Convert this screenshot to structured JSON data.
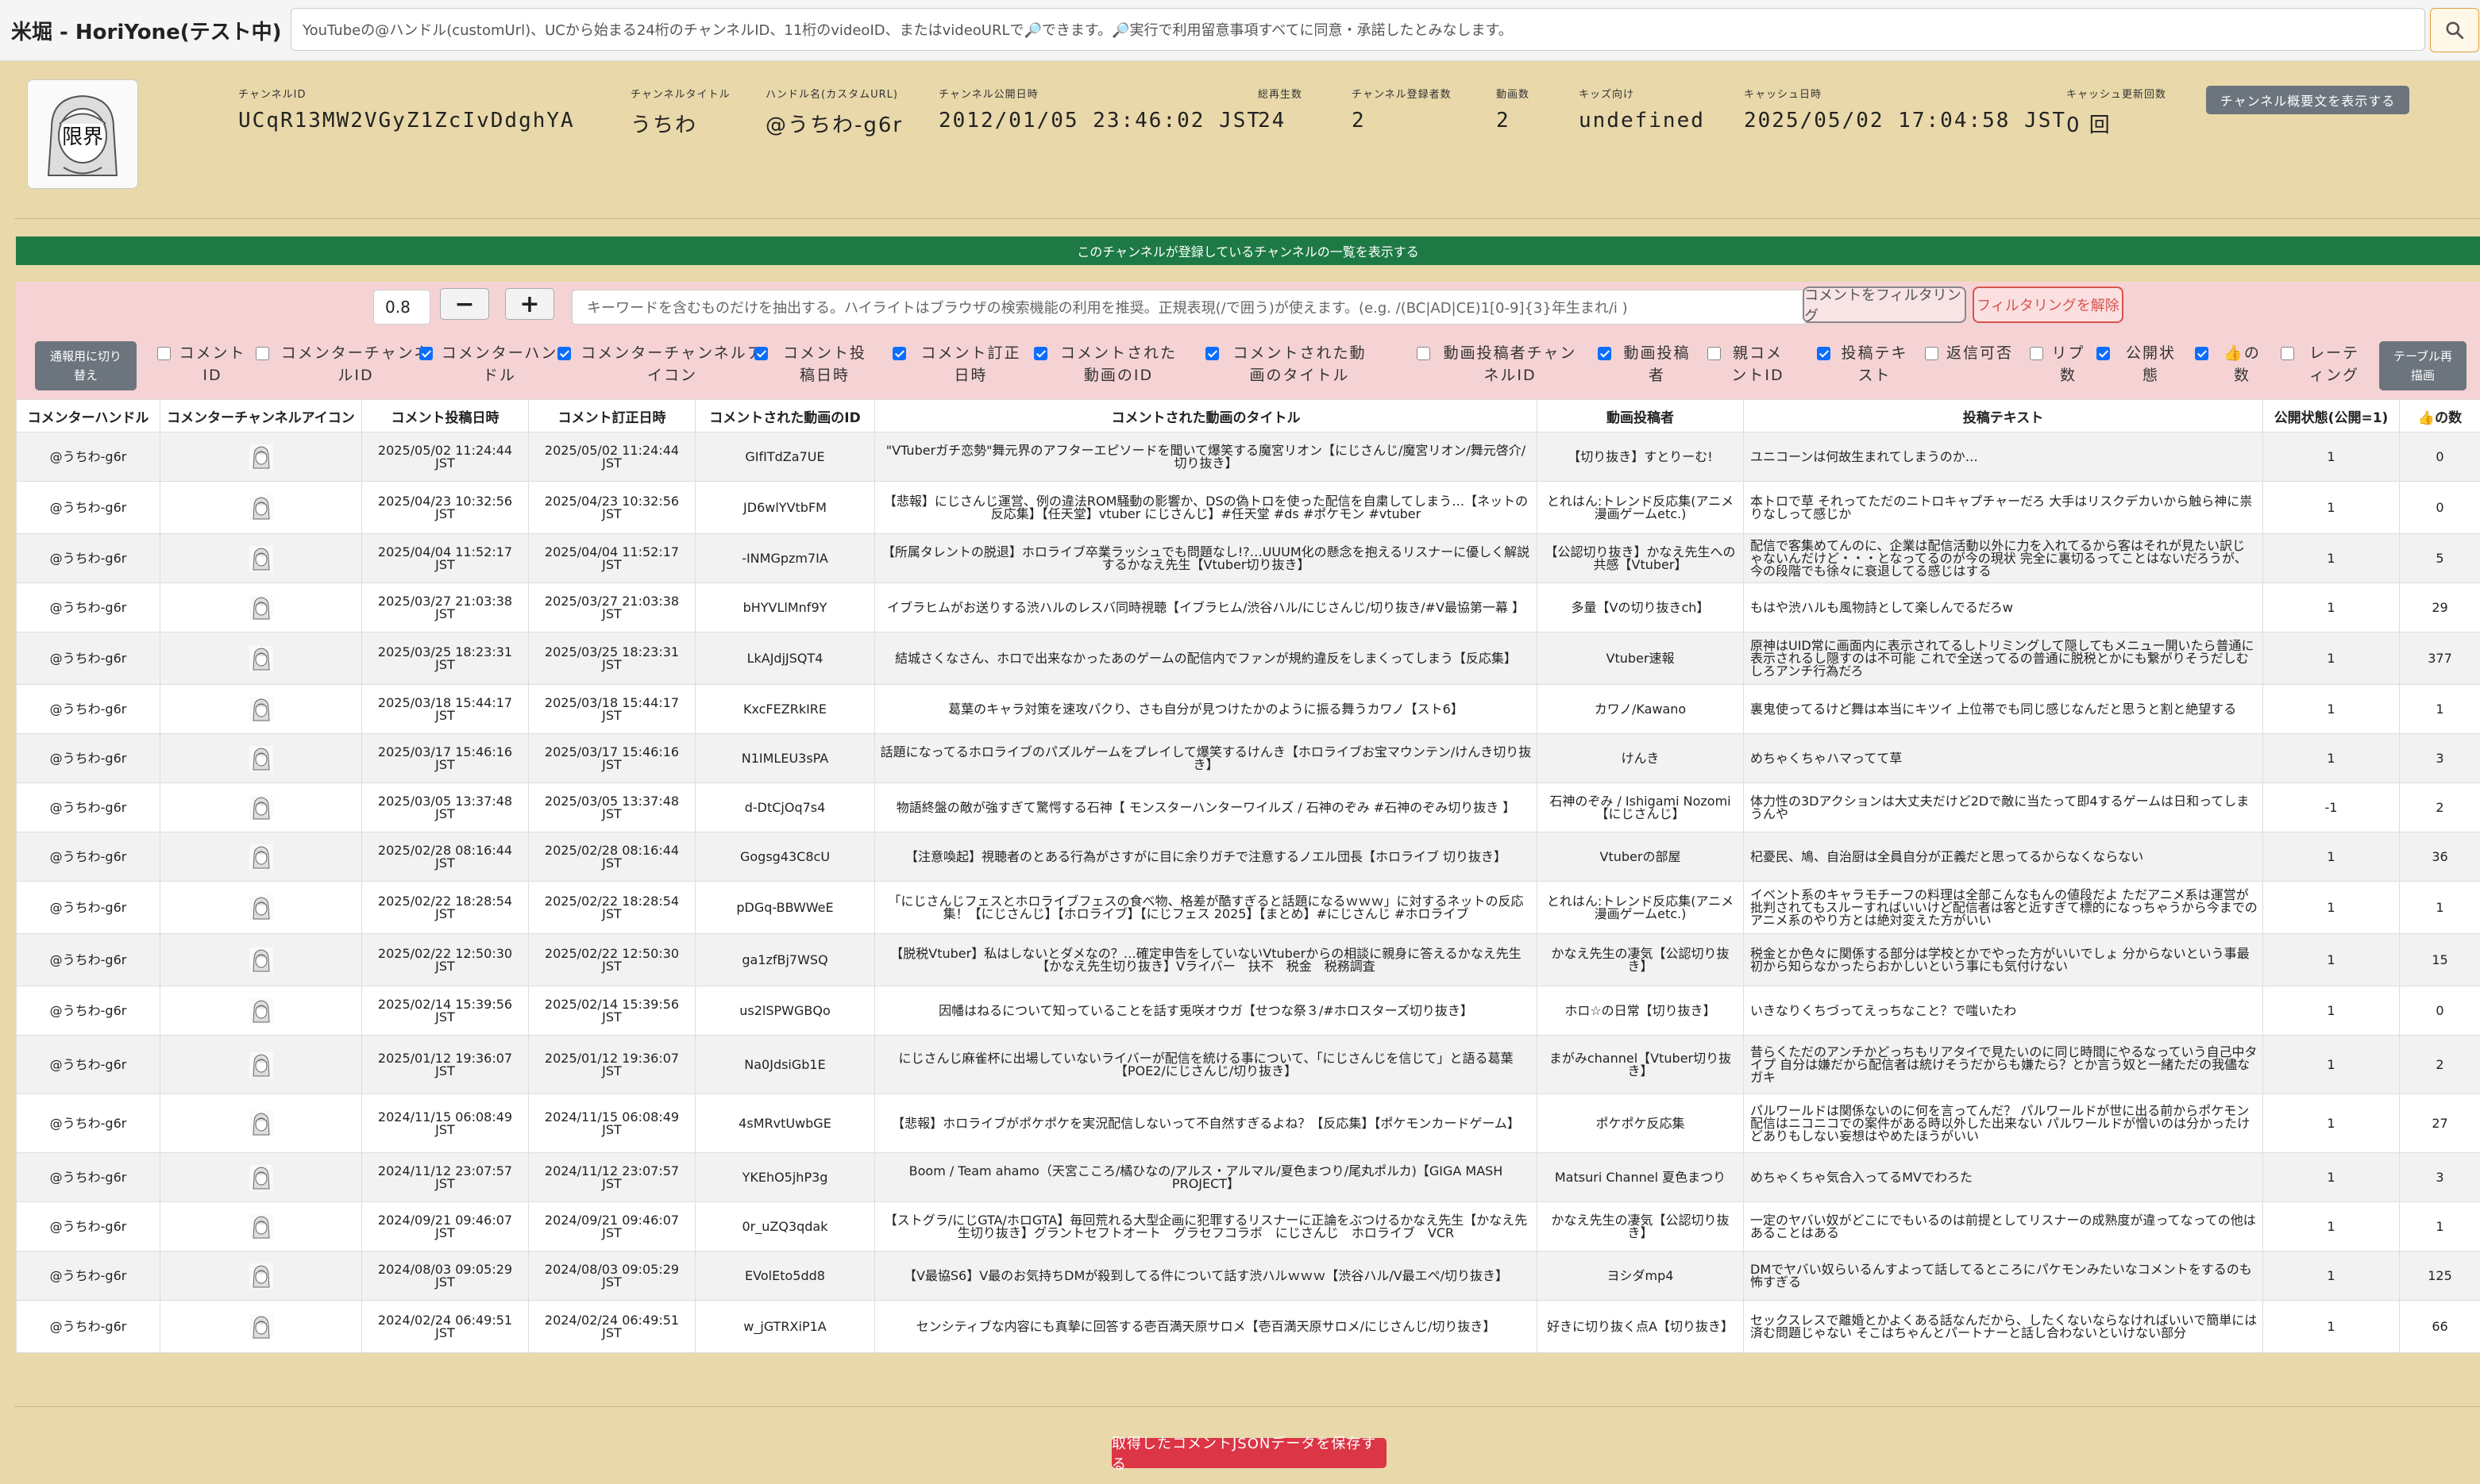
{
  "header": {
    "title": "米堀 - HoriYone(テスト中)",
    "search_placeholder": "YouTubeの@ハンドル(customUrl)、UCから始まる24桁のチャンネルID、11桁のvideoID、またはvideoURLで🔎できます。🔎実行で利用留意事項すべてに同意・承諾したとみなします。"
  },
  "channel": {
    "fields": [
      {
        "label": "チャンネルID",
        "value": "UCqR13MW2VGyZ1ZcIvDdghYA"
      },
      {
        "label": "チャンネルタイトル",
        "value": "うちわ"
      },
      {
        "label": "ハンドル名(カスタムURL)",
        "value": "@うちわ-g6r"
      },
      {
        "label": "チャンネル公開日時",
        "value": "2012/01/05 23:46:02 JST"
      },
      {
        "label": "総再生数",
        "value": "24"
      },
      {
        "label": "チャンネル登録者数",
        "value": "2"
      },
      {
        "label": "動画数",
        "value": "2"
      },
      {
        "label": "キッズ向け",
        "value": "undefined"
      },
      {
        "label": "キャッシュ日時",
        "value": "2025/05/02 17:04:58 JST"
      },
      {
        "label": "キャッシュ更新回数",
        "value": "0 回"
      }
    ],
    "show_description_label": "チャンネル概要文を表示する",
    "avatar_text": "限界"
  },
  "subscriptions_bar": "このチャンネルが登録しているチャンネルの一覧を表示する",
  "filter": {
    "threshold": "0.8",
    "minus_label": "−",
    "plus_label": "+",
    "keyword_placeholder": "キーワードを含むものだけを抽出する。ハイライトはブラウザの検索機能の利用を推奨。正規表現(/で囲う)が使えます。(e.g. /(BC|AD|CE)1[0-9]{3}年生まれ/i )",
    "filter_button": "コメントをフィルタリング",
    "clear_button": "フィルタリングを解除",
    "switch_button": "通報用に切り替え",
    "redraw_button": "テーブル再描画",
    "columns": [
      {
        "label": "コメントID",
        "checked": false
      },
      {
        "label": "コメンターチャンネルID",
        "checked": false
      },
      {
        "label": "コメンターハンドル",
        "checked": true
      },
      {
        "label": "コメンターチャンネルアイコン",
        "checked": true
      },
      {
        "label": "コメント投稿日時",
        "checked": true
      },
      {
        "label": "コメント訂正日時",
        "checked": true
      },
      {
        "label": "コメントされた動画のID",
        "checked": true
      },
      {
        "label": "コメントされた動画のタイトル",
        "checked": true
      },
      {
        "label": "動画投稿者チャンネルID",
        "checked": false
      },
      {
        "label": "動画投稿者",
        "checked": true
      },
      {
        "label": "親コメントID",
        "checked": false
      },
      {
        "label": "投稿テキスト",
        "checked": true
      },
      {
        "label": "返信可否",
        "checked": false
      },
      {
        "label": "リプ数",
        "checked": false
      },
      {
        "label": "公開状態",
        "checked": true
      },
      {
        "label": "👍の数",
        "checked": true
      },
      {
        "label": "レーティング",
        "checked": false
      }
    ]
  },
  "table": {
    "headers": [
      "コメンターハンドル",
      "コメンターチャンネルアイコン",
      "コメント投稿日時",
      "コメント訂正日時",
      "コメントされた動画のID",
      "コメントされた動画のタイトル",
      "動画投稿者",
      "投稿テキスト",
      "公開状態(公開=1)",
      "👍の数"
    ],
    "rows": [
      {
        "handle": "@うちわ-g6r",
        "posted": "2025/05/02 11:24:44 JST",
        "edited": "2025/05/02 11:24:44 JST",
        "video_id": "GIfITdZa7UE",
        "title": "\"VTuberガチ恋勢\"舞元界のアフターエピソードを聞いて爆笑する魔宮リオン【にじさんじ/魔宮リオン/舞元啓介/切り抜き】",
        "uploader": "【切り抜き】すとりーむ!",
        "text": "ユニコーンは何故生まれてしまうのか…",
        "status": "1",
        "likes": "0"
      },
      {
        "handle": "@うちわ-g6r",
        "posted": "2025/04/23 10:32:56 JST",
        "edited": "2025/04/23 10:32:56 JST",
        "video_id": "JD6wlYVtbFM",
        "title": "【悲報】にじさんじ運営、例の違法ROM騒動の影響か、DSの偽トロを使った配信を自粛してしまう…【ネットの反応集】【任天堂】vtuber にじさんじ】#任天堂 #ds #ポケモン #vtuber",
        "uploader": "とれはん:トレンド反応集(アニメ漫画ゲームetc.)",
        "text": "本トロで草 それってただのニトロキャプチャーだろ 大手はリスクデカいから触ら神に祟りなしって感じか",
        "status": "1",
        "likes": "0"
      },
      {
        "handle": "@うちわ-g6r",
        "posted": "2025/04/04 11:52:17 JST",
        "edited": "2025/04/04 11:52:17 JST",
        "video_id": "-INMGpzm7IA",
        "title": "【所属タレントの脱退】ホロライブ卒業ラッシュでも問題なし!?…UUUM化の懸念を抱えるリスナーに優しく解説するかなえ先生【Vtuber切り抜き】",
        "uploader": "【公認切り抜き】かなえ先生への共感【Vtuber】",
        "text": "配信で客集めてんのに、企業は配信活動以外に力を入れてるから客はそれが見たい訳じゃないんだけど・・・となってるのが今の現状 完全に裏切るってことはないだろうが、今の段階でも徐々に衰退してる感じはする",
        "status": "1",
        "likes": "5"
      },
      {
        "handle": "@うちわ-g6r",
        "posted": "2025/03/27 21:03:38 JST",
        "edited": "2025/03/27 21:03:38 JST",
        "video_id": "bHYVLlMnf9Y",
        "title": "イブラヒムがお送りする渋ハルのレスバ同時視聴【イブラヒム/渋谷ハル/にじさんじ/切り抜き/#V最協第一幕 】",
        "uploader": "多量【Vの切り抜きch】",
        "text": "もはや渋ハルも風物詩として楽しんでるだろw",
        "status": "1",
        "likes": "29"
      },
      {
        "handle": "@うちわ-g6r",
        "posted": "2025/03/25 18:23:31 JST",
        "edited": "2025/03/25 18:23:31 JST",
        "video_id": "LkAJdjJSQT4",
        "title": "結城さくなさん、ホロで出来なかったあのゲームの配信内でファンが規約違反をしまくってしまう【反応集】",
        "uploader": "Vtuber速報",
        "text": "原神はUID常に画面内に表示されてるしトリミングして隠してもメニュー開いたら普通に表示されるし隠すのは不可能 これで全送ってるの普通に脱税とかにも繋がりそうだしむしろアンチ行為だろ",
        "status": "1",
        "likes": "377"
      },
      {
        "handle": "@うちわ-g6r",
        "posted": "2025/03/18 15:44:17 JST",
        "edited": "2025/03/18 15:44:17 JST",
        "video_id": "KxcFEZRkIRE",
        "title": "葛葉のキャラ対策を速攻パクり、さも自分が見つけたかのように振る舞うカワノ【スト6】",
        "uploader": "カワノ/Kawano",
        "text": "裏鬼使ってるけど舞は本当にキツイ 上位帯でも同じ感じなんだと思うと割と絶望する",
        "status": "1",
        "likes": "1"
      },
      {
        "handle": "@うちわ-g6r",
        "posted": "2025/03/17 15:46:16 JST",
        "edited": "2025/03/17 15:46:16 JST",
        "video_id": "N1IMLEU3sPA",
        "title": "話題になってるホロライブのパズルゲームをプレイして爆笑するけんき【ホロライブお宝マウンテン/けんき切り抜き】",
        "uploader": "けんき",
        "text": "めちゃくちゃハマってて草",
        "status": "1",
        "likes": "3"
      },
      {
        "handle": "@うちわ-g6r",
        "posted": "2025/03/05 13:37:48 JST",
        "edited": "2025/03/05 13:37:48 JST",
        "video_id": "d-DtCjOq7s4",
        "title": "物語終盤の敵が強すぎて驚愕する石神【 モンスターハンターワイルズ / 石神のぞみ #石神のぞみ切り抜き 】",
        "uploader": "石神のぞみ / Ishigami Nozomi【にじさんじ】",
        "text": "体力性の3Dアクションは大丈夫だけど2Dで敵に当たって即4するゲームは日和ってしまうんや",
        "status": "-1",
        "likes": "2"
      },
      {
        "handle": "@うちわ-g6r",
        "posted": "2025/02/28 08:16:44 JST",
        "edited": "2025/02/28 08:16:44 JST",
        "video_id": "Gogsg43C8cU",
        "title": "【注意喚起】視聴者のとある行為がさすがに目に余りガチで注意するノエル団長【ホロライブ 切り抜き】",
        "uploader": "Vtuberの部屋",
        "text": "杞憂民、鳩、自治厨は全員自分が正義だと思ってるからなくならない",
        "status": "1",
        "likes": "36"
      },
      {
        "handle": "@うちわ-g6r",
        "posted": "2025/02/22 18:28:54 JST",
        "edited": "2025/02/22 18:28:54 JST",
        "video_id": "pDGq-BBWWeE",
        "title": "「にじさんじフェスとホロライブフェスの食べ物、格差が酷すぎると話題になるｗｗｗ」に対するネットの反応集！【にじさんじ】【ホロライブ】【にじフェス 2025】【まとめ】#にじさんじ #ホロライブ",
        "uploader": "とれはん:トレンド反応集(アニメ漫画ゲームetc.)",
        "text": "イベント系のキャラモチーフの料理は全部こんなもんの値段だよ ただアニメ系は運営が批判されてもスルーすればいいけど配信者は客と近すぎて標的になっちゃうから今までのアニメ系のやり方とは絶対変えた方がいい",
        "status": "1",
        "likes": "1"
      },
      {
        "handle": "@うちわ-g6r",
        "posted": "2025/02/22 12:50:30 JST",
        "edited": "2025/02/22 12:50:30 JST",
        "video_id": "ga1zfBj7WSQ",
        "title": "【脱税Vtuber】私はしないとダメなの？…確定申告をしていないVtuberからの相談に親身に答えるかなえ先生【かなえ先生切り抜き】Vライバー　扶不　税金　税務調査",
        "uploader": "かなえ先生の凄気【公認切り抜き】",
        "text": "税金とか色々に関係する部分は学校とかでやった方がいいでしょ 分からないという事最初から知らなかったらおかしいという事にも気付けない",
        "status": "1",
        "likes": "15"
      },
      {
        "handle": "@うちわ-g6r",
        "posted": "2025/02/14 15:39:56 JST",
        "edited": "2025/02/14 15:39:56 JST",
        "video_id": "us2lSPWGBQo",
        "title": "因幡はねるについて知っていることを話す兎咲オウガ【せつな祭３/#ホロスターズ切り抜き】",
        "uploader": "ホロ☆の日常【切り抜き】",
        "text": "いきなりくちづってえっちなこと？で嗤いたわ",
        "status": "1",
        "likes": "0"
      },
      {
        "handle": "@うちわ-g6r",
        "posted": "2025/01/12 19:36:07 JST",
        "edited": "2025/01/12 19:36:07 JST",
        "video_id": "Na0JdsiGb1E",
        "title": "にじさんじ麻雀杯に出場していないライバーが配信を統ける事について、「にじさんじを信じて」と語る葛葉【POE2/にじさんじ/切り抜き】",
        "uploader": "まがみchannel【Vtuber切り抜き】",
        "text": "昔らくただのアンチかどっちもリアタイで見たいのに同じ時間にやるなっていう自己中タイプ 自分は嫌だから配信者は統けそうだからも嫌たら？とか言う奴と一緒ただの我儘なガキ",
        "status": "1",
        "likes": "2"
      },
      {
        "handle": "@うちわ-g6r",
        "posted": "2024/11/15 06:08:49 JST",
        "edited": "2024/11/15 06:08:49 JST",
        "video_id": "4sMRvtUwbGE",
        "title": "【悲報】ホロライブがポケポケを実況配信しないって不自然すぎるよね？【反応集】【ポケモンカードゲーム】",
        "uploader": "ポケポケ反応集",
        "text": "パルワールドは関係ないのに何を言ってんだ？ パルワールドが世に出る前からポケモン配信はニコニコでの案件がある時以外した出来ない パルワールドが憎いのは分かったけどありもしない妄想はやめたほうがいい",
        "status": "1",
        "likes": "27"
      },
      {
        "handle": "@うちわ-g6r",
        "posted": "2024/11/12 23:07:57 JST",
        "edited": "2024/11/12 23:07:57 JST",
        "video_id": "YKEhO5jhP3g",
        "title": "Boom / Team ahamo（天宮こころ/橘ひなの/アルス・アルマル/夏色まつり/尾丸ポルカ)【GIGA MASH PROJECT】",
        "uploader": "Matsuri Channel 夏色まつり",
        "text": "めちゃくちゃ気合入ってるMVでわろた",
        "status": "1",
        "likes": "3"
      },
      {
        "handle": "@うちわ-g6r",
        "posted": "2024/09/21 09:46:07 JST",
        "edited": "2024/09/21 09:46:07 JST",
        "video_id": "0r_uZQ3qdak",
        "title": "【ストグラ/にじGTA/ホロGTA】毎回荒れる大型企画に犯罪するリスナーに正論をぶつけるかなえ先生【かなえ先生切り抜き】グラントセフトオート　グラセフコラボ　にじさんじ　ホロライブ　VCR",
        "uploader": "かなえ先生の凄気【公認切り抜き】",
        "text": "一定のヤバい奴がどこにでもいるのは前提としてリスナーの成熟度が違ってなっての他はあることはある",
        "status": "1",
        "likes": "1"
      },
      {
        "handle": "@うちわ-g6r",
        "posted": "2024/08/03 09:05:29 JST",
        "edited": "2024/08/03 09:05:29 JST",
        "video_id": "EVolEto5dd8",
        "title": "【V最協S6】V最のお気持ちDMが殺到してる件について話す渋ハルｗｗｗ【渋谷ハル/V最エペ/切り抜き】",
        "uploader": "ヨシダmp4",
        "text": "DMでヤバい奴らいるんすよって話してるところにパケモンみたいなコメントをするのも怖すぎる",
        "status": "1",
        "likes": "125"
      },
      {
        "handle": "@うちわ-g6r",
        "posted": "2024/02/24 06:49:51 JST",
        "edited": "2024/02/24 06:49:51 JST",
        "video_id": "w_jGTRXiP1A",
        "title": "センシティブな内容にも真摯に回答する壱百満天原サロメ【壱百満天原サロメ/にじさんじ/切り抜き】",
        "uploader": "好きに切り抜く点A【切り抜き】",
        "text": "セックスレスで離婚とかよくある話なんだから、したくないならなければいいで簡単には済む問題じゃない そこはちゃんとパートナーと話し合わないといけない部分",
        "status": "1",
        "likes": "66"
      }
    ]
  },
  "save_button": "取得したコメントJSONデータを保存する",
  "colors": {
    "background": "#e8d8aa",
    "subs_bar": "#1e7a45",
    "filter_panel": "#f5d3d5",
    "danger": "#dc3545",
    "secondary": "#6c757d"
  }
}
